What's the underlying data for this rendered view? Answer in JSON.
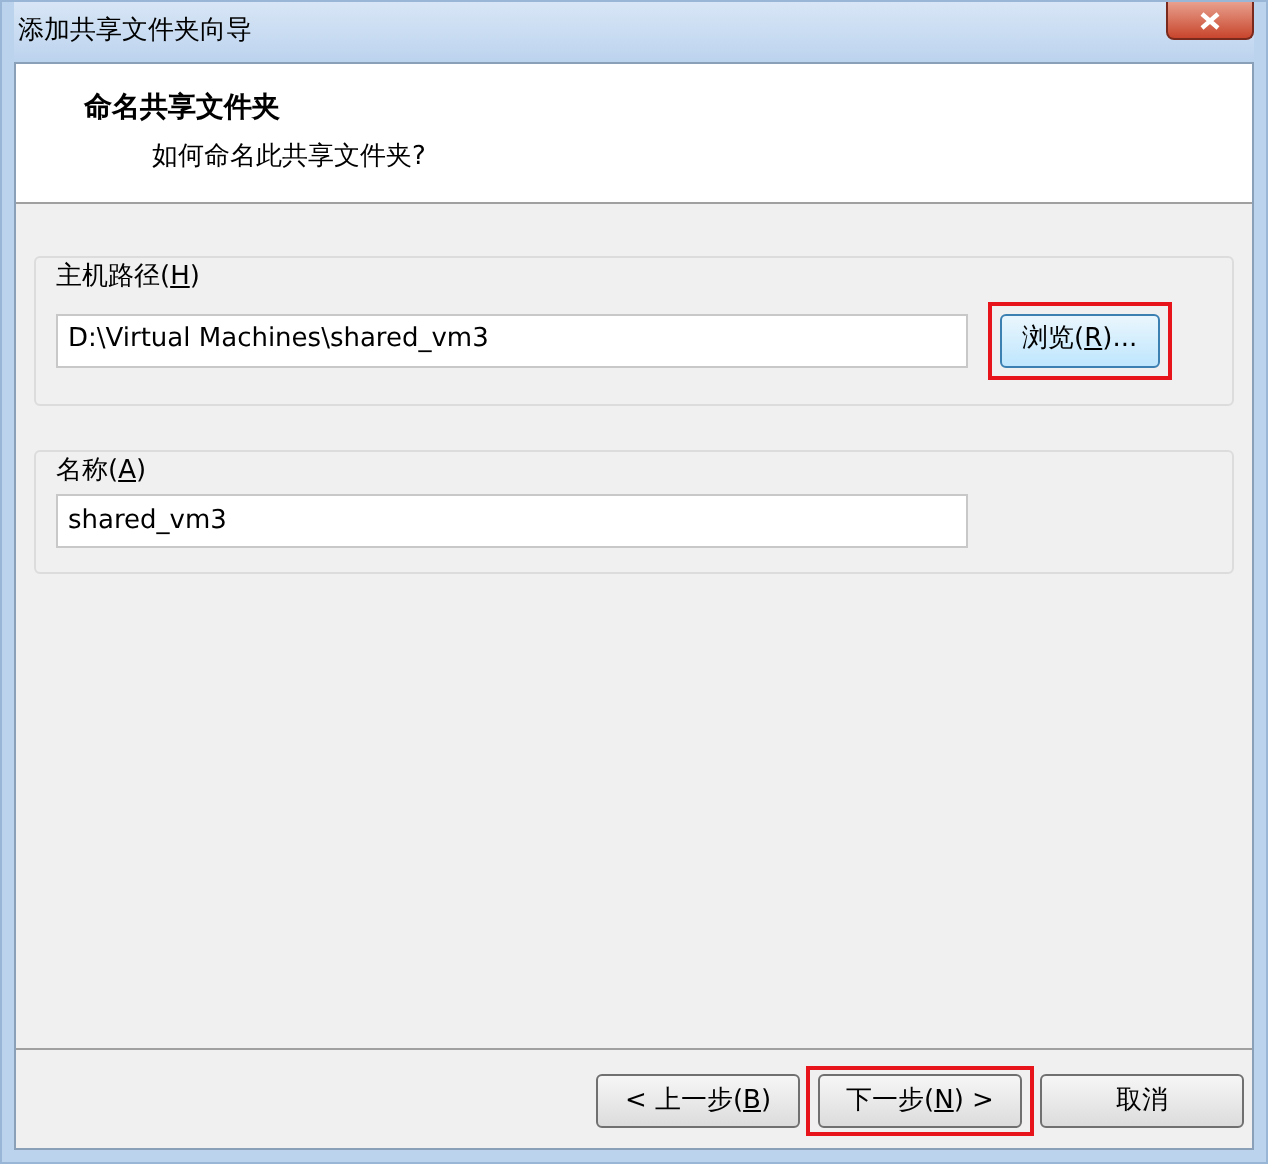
{
  "window": {
    "title": "添加共享文件夹向导"
  },
  "header": {
    "title": "命名共享文件夹",
    "subtitle": "如何命名此共享文件夹?"
  },
  "groups": [
    {
      "label": {
        "before": "主机路径(",
        "key": "H",
        "after": ")"
      },
      "value": "D:\\Virtual Machines\\shared_vm3",
      "button": {
        "before": "浏览(",
        "key": "R",
        "after": ")...",
        "highlighted": true
      }
    },
    {
      "label": {
        "before": "名称(",
        "key": "A",
        "after": ")"
      },
      "value": "shared_vm3"
    }
  ],
  "buttons": [
    {
      "before": "< 上一步(",
      "key": "B",
      "after": ")",
      "highlighted": false
    },
    {
      "before": "下一步(",
      "key": "N",
      "after": ") >",
      "highlighted": true
    },
    {
      "before": "取消",
      "highlighted": false
    }
  ]
}
